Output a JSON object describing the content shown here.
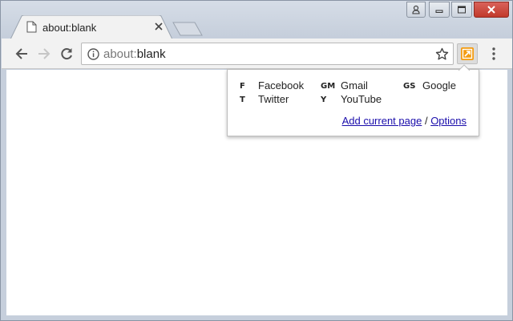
{
  "tab": {
    "title": "about:blank"
  },
  "address_bar": {
    "scheme": "about:",
    "rest": "blank"
  },
  "popup": {
    "shortcuts": [
      {
        "key": "F",
        "label": "Facebook"
      },
      {
        "key": "GM",
        "label": "Gmail"
      },
      {
        "key": "GS",
        "label": "Google"
      },
      {
        "key": "T",
        "label": "Twitter"
      },
      {
        "key": "Y",
        "label": "YouTube"
      }
    ],
    "add_current_page": "Add current page",
    "separator": "/",
    "options": "Options"
  },
  "colors": {
    "extension_accent": "#f39c12",
    "link": "#1a0dab",
    "close_button": "#c1392b"
  },
  "icons": [
    "page-icon",
    "close-icon",
    "new-tab-icon",
    "profile-icon",
    "minimize-icon",
    "maximize-icon",
    "window-close-icon",
    "back-arrow-icon",
    "forward-arrow-icon",
    "reload-icon",
    "info-icon",
    "star-icon",
    "extension-icon",
    "menu-dots-icon"
  ]
}
